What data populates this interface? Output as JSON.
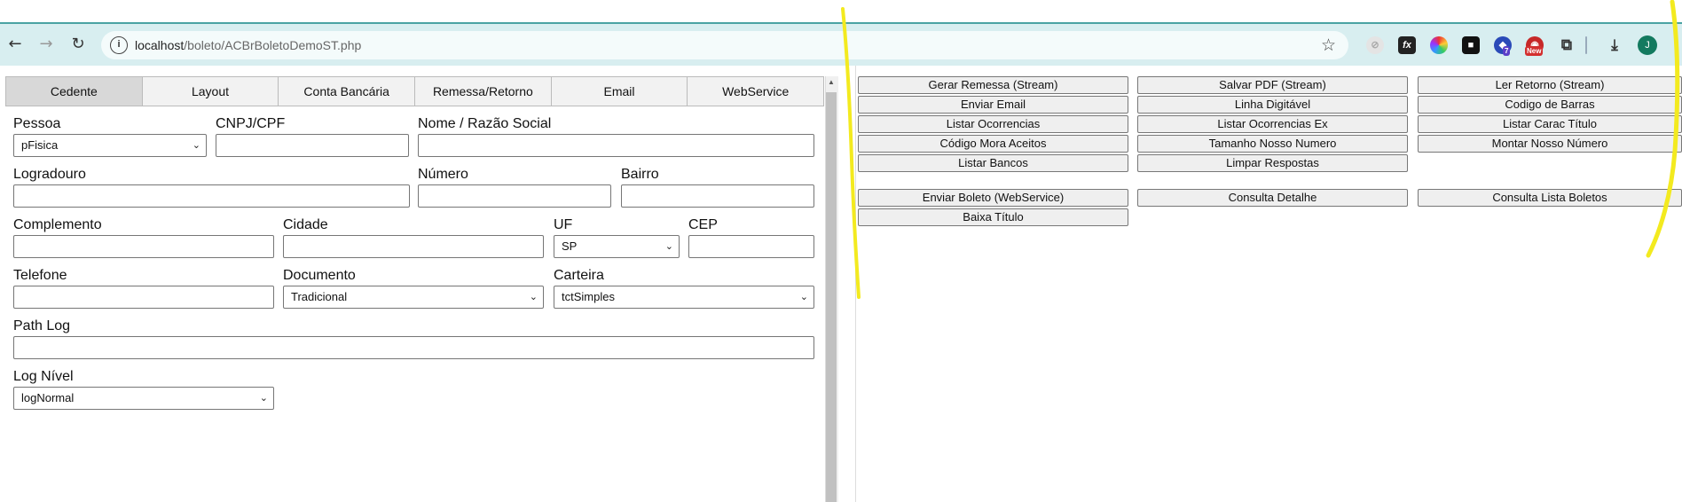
{
  "browser": {
    "url_host": "localhost",
    "url_path": "/boleto/ACBrBoletoDemoST.php",
    "avatar_initial": "J",
    "ext_badge_count": "7",
    "ext_badge_new": "New"
  },
  "tabs": [
    "Cedente",
    "Layout",
    "Conta Bancária",
    "Remessa/Retorno",
    "Email",
    "WebService"
  ],
  "form": {
    "pessoa_label": "Pessoa",
    "pessoa_value": "pFisica",
    "cnpj_label": "CNPJ/CPF",
    "cnpj_value": "",
    "nome_label": "Nome / Razão Social",
    "nome_value": "",
    "logradouro_label": "Logradouro",
    "logradouro_value": "",
    "numero_label": "Número",
    "numero_value": "",
    "bairro_label": "Bairro",
    "bairro_value": "",
    "complemento_label": "Complemento",
    "complemento_value": "",
    "cidade_label": "Cidade",
    "cidade_value": "",
    "uf_label": "UF",
    "uf_value": "SP",
    "cep_label": "CEP",
    "cep_value": "",
    "telefone_label": "Telefone",
    "telefone_value": "",
    "documento_label": "Documento",
    "documento_value": "Tradicional",
    "carteira_label": "Carteira",
    "carteira_value": "tctSimples",
    "pathlog_label": "Path Log",
    "pathlog_value": "",
    "lognivel_label": "Log Nível",
    "lognivel_value": "logNormal"
  },
  "actions": {
    "gerar_remessa": "Gerar Remessa (Stream)",
    "salvar_pdf": "Salvar PDF (Stream)",
    "ler_retorno": "Ler Retorno (Stream)",
    "enviar_email": "Enviar Email",
    "linha_digitavel": "Linha Digitável",
    "codigo_barras": "Codigo de Barras",
    "listar_ocorrencias": "Listar Ocorrencias",
    "listar_ocorrencias_ex": "Listar Ocorrencias Ex",
    "listar_carac_titulo": "Listar Carac Título",
    "codigo_mora": "Código Mora Aceitos",
    "tamanho_nosso_numero": "Tamanho Nosso Numero",
    "montar_nosso_numero": "Montar Nosso Número",
    "listar_bancos": "Listar Bancos",
    "limpar_respostas": "Limpar Respostas",
    "enviar_boleto_ws": "Enviar Boleto (WebService)",
    "consulta_detalhe": "Consulta Detalhe",
    "consulta_lista_boletos": "Consulta Lista Boletos",
    "baixa_titulo": "Baixa Título"
  },
  "colors": {
    "highlight": "#f3ea1f",
    "toolbar": "#d8eef0"
  }
}
